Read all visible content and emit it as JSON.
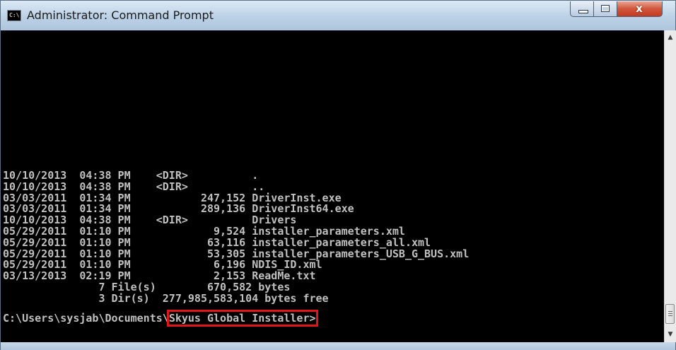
{
  "window": {
    "title": "Administrator: Command Prompt",
    "icon": "command-prompt-icon",
    "icon_text": "C:\\",
    "close_glyph": "x"
  },
  "console": {
    "listing": [
      "10/10/2013  04:38 PM    <DIR>          .",
      "10/10/2013  04:38 PM    <DIR>          ..",
      "03/03/2011  01:34 PM           247,152 DriverInst.exe",
      "03/03/2011  01:34 PM           289,136 DriverInst64.exe",
      "10/10/2013  04:38 PM    <DIR>          Drivers",
      "05/29/2011  01:10 PM             9,524 installer_parameters.xml",
      "05/29/2011  01:10 PM            63,116 installer_parameters_all.xml",
      "05/29/2011  01:10 PM            53,305 installer_parameters_USB_G_BUS.xml",
      "05/29/2011  01:10 PM             6,196 NDIS_ID.xml",
      "03/13/2013  02:19 PM             2,153 ReadMe.txt",
      "               7 File(s)        670,582 bytes",
      "               3 Dir(s)  277,985,583,104 bytes free"
    ],
    "prompt_path": "C:\\Users\\sysjab\\Documents\\",
    "prompt_highlight": "Skyus Global Installer>"
  },
  "colors": {
    "console_bg": "#000000",
    "console_text": "#c0c0c0",
    "highlight_box": "#e0161a",
    "close_button": "#c9432a"
  },
  "scrollbar": {
    "up_arrow": "▲",
    "down_arrow": "▼"
  }
}
